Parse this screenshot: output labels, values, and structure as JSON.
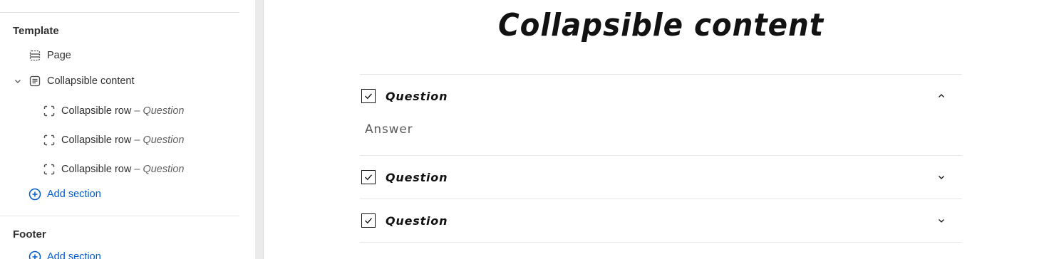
{
  "sidebar": {
    "template_group": {
      "title": "Template",
      "items": [
        {
          "label": "Page",
          "icon": "page-layout-icon"
        },
        {
          "label": "Collapsible content",
          "icon": "section-icon",
          "expanded": true
        },
        {
          "label": "Collapsible row",
          "suffix": "– Question",
          "icon": "block-icon"
        },
        {
          "label": "Collapsible row",
          "suffix": "– Question",
          "icon": "block-icon"
        },
        {
          "label": "Collapsible row",
          "suffix": "– Question",
          "icon": "block-icon"
        }
      ],
      "add_section": "Add section"
    },
    "footer_group": {
      "title": "Footer",
      "add_section": "Add section"
    }
  },
  "preview": {
    "heading": "Collapsible content",
    "rows": [
      {
        "title": "Question",
        "expanded": true,
        "answer": "Answer"
      },
      {
        "title": "Question",
        "expanded": false
      },
      {
        "title": "Question",
        "expanded": false
      }
    ]
  },
  "colors": {
    "accent_link": "#005bd3",
    "text_primary": "#303030",
    "heading": "#121212"
  }
}
